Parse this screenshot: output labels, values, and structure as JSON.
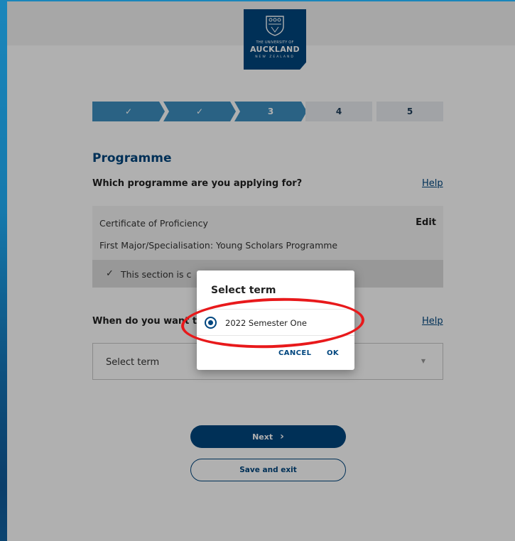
{
  "logo": {
    "line1": "THE UNIVERSITY OF",
    "line2": "AUCKLAND",
    "line3": "NEW ZEALAND",
    "color": "#00467f"
  },
  "stepper": {
    "steps": [
      {
        "label": "✓",
        "state": "done"
      },
      {
        "label": "✓",
        "state": "done"
      },
      {
        "label": "3",
        "state": "current"
      },
      {
        "label": "4",
        "state": "todo"
      },
      {
        "label": "5",
        "state": "todo"
      }
    ]
  },
  "section": {
    "title": "Programme",
    "question": "Which programme are you applying for?",
    "help": "Help"
  },
  "summary": {
    "programme": "Certificate of Proficiency",
    "edit": "Edit",
    "major": "First Major/Specialisation: Young Scholars Programme",
    "status_text": "This section is c",
    "check_icon": "check-icon"
  },
  "term": {
    "question": "When do you want t",
    "help": "Help",
    "select_value": "Select term"
  },
  "buttons": {
    "next": "Next",
    "save": "Save and exit"
  },
  "dialog": {
    "title": "Select term",
    "option": "2022 Semester One",
    "option_selected": true,
    "cancel": "CANCEL",
    "ok": "OK"
  },
  "annotation": {
    "color": "#e8191b"
  }
}
